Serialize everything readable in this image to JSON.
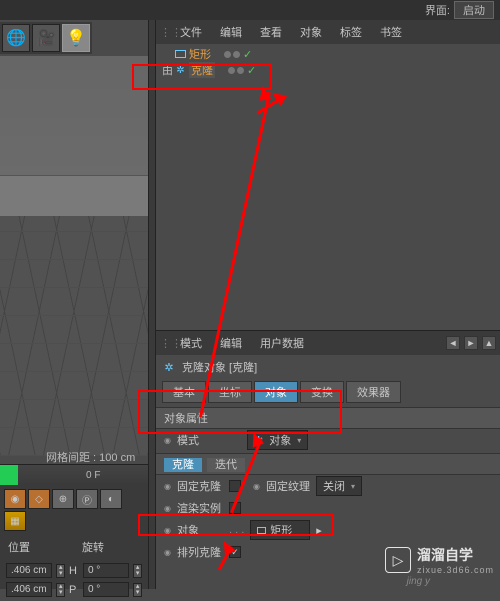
{
  "topbar": {
    "label": "界面:",
    "value": "启动"
  },
  "obj_manager": {
    "menu": [
      "文件",
      "编辑",
      "查看",
      "对象",
      "标签",
      "书签"
    ],
    "tree": [
      {
        "name": "矩形",
        "expander": "",
        "icon": "rect"
      },
      {
        "name": "克隆",
        "expander": "由",
        "icon": "clone"
      }
    ]
  },
  "attr_manager": {
    "menu": [
      "模式",
      "编辑",
      "用户数据"
    ],
    "title": "克隆对象 [克隆]",
    "tabs": [
      "基本",
      "坐标",
      "对象",
      "变换",
      "效果器"
    ],
    "group1": "对象属性",
    "mode": {
      "label": "模式",
      "value": "对象"
    },
    "group2_tabs": [
      "克隆",
      "迭代"
    ],
    "fixclone": {
      "label": "固定克隆",
      "fixtex": "固定纹理",
      "fixtex_val": "关闭"
    },
    "render_inst": {
      "label": "渲染实例"
    },
    "object_link": {
      "label": "对象",
      "value": "矩形"
    },
    "arrange": {
      "label": "排列克隆"
    }
  },
  "viewport": {
    "grid_label": "网格间距 : 100 cm"
  },
  "timeline": {
    "frame": "0 F",
    "pos_header": "位置",
    "rot_header": "旋转",
    "rows": [
      {
        "axis": "",
        "val": ".406 cm",
        "ax2": "H",
        "val2": "0 °"
      },
      {
        "axis": "",
        "val": ".406 cm",
        "ax2": "P",
        "val2": "0 °"
      }
    ]
  },
  "watermark": {
    "brand": "溜溜自学",
    "url": "zixue.3d66.com"
  }
}
